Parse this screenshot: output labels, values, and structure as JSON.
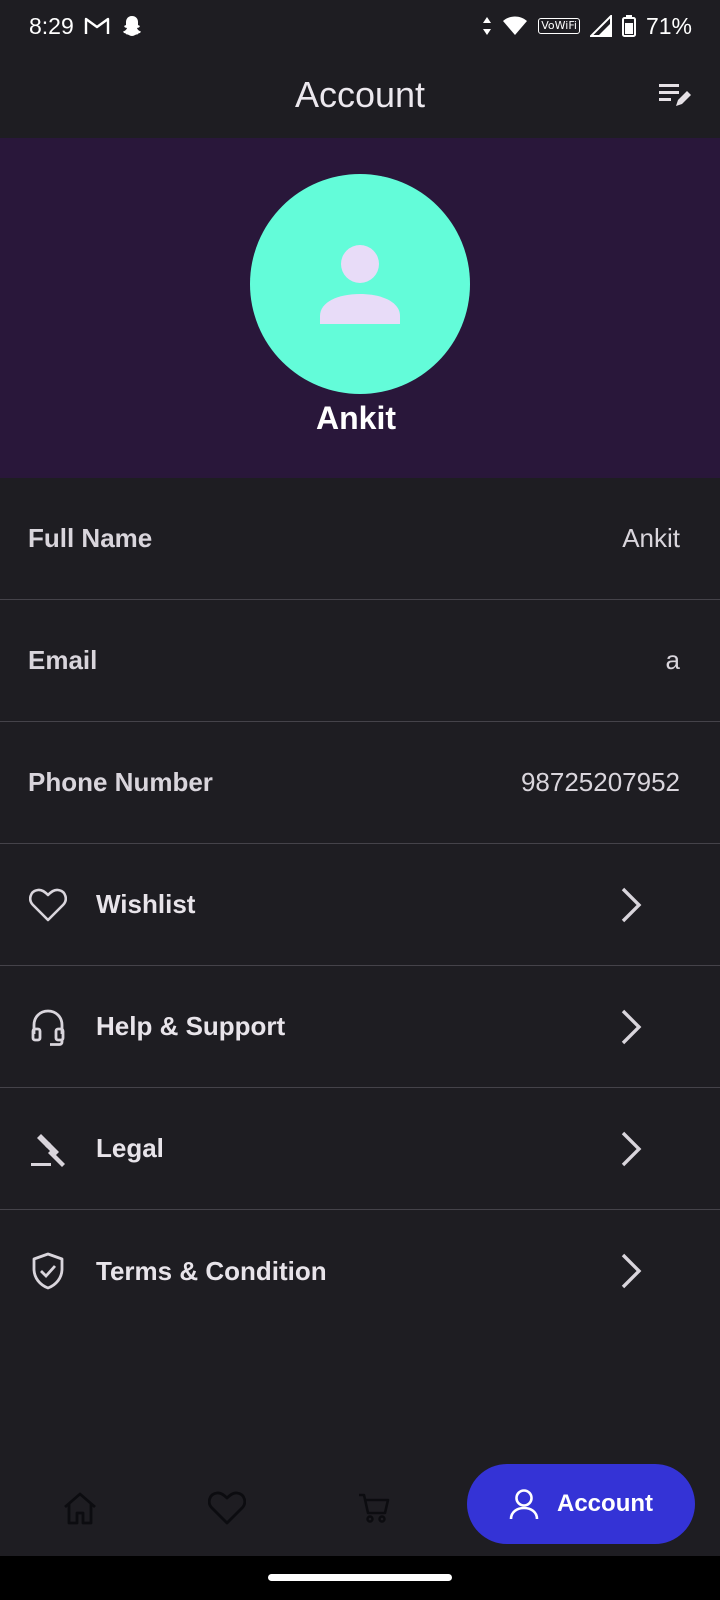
{
  "status_bar": {
    "time": "8:29",
    "battery_percent": "71%",
    "wifi_badge": "VoWiFi",
    "icons": [
      "gmail-icon",
      "snapchat-icon",
      "data-arrows-icon",
      "wifi-icon",
      "signal-icon",
      "battery-icon"
    ]
  },
  "app_bar": {
    "title": "Account",
    "action_icon": "edit-list-icon"
  },
  "profile": {
    "name": "Ankit",
    "avatar_icon": "person-icon",
    "avatar_color": "#63fcd9",
    "header_color": "#29173a"
  },
  "info_rows": [
    {
      "label": "Full Name",
      "value": "Ankit"
    },
    {
      "label": "Email",
      "value": "a"
    },
    {
      "label": "Phone Number",
      "value": "98725207952"
    }
  ],
  "menu_rows": [
    {
      "label": "Wishlist",
      "icon": "heart-icon"
    },
    {
      "label": "Help & Support",
      "icon": "headset-icon"
    },
    {
      "label": "Legal",
      "icon": "gavel-icon"
    },
    {
      "label": "Terms & Condition",
      "icon": "shield-check-icon"
    }
  ],
  "bottom_nav": {
    "items": [
      {
        "icon": "home-icon"
      },
      {
        "icon": "heart-icon"
      },
      {
        "icon": "cart-icon"
      }
    ],
    "active": {
      "label": "Account",
      "icon": "person-outline-icon",
      "color": "#3433d6"
    }
  }
}
